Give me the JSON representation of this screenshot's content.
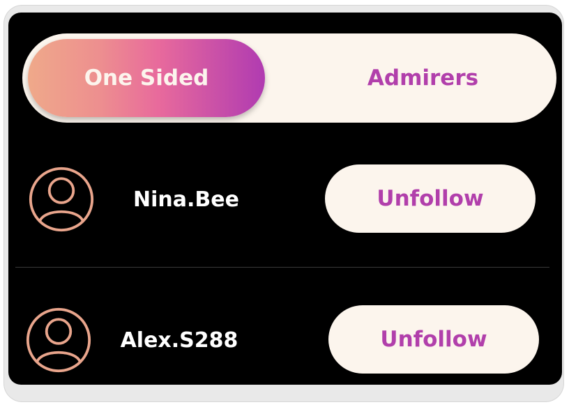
{
  "tabs": {
    "active": "One Sided",
    "inactive": "Admirers"
  },
  "rows": [
    {
      "username": "Nina.Bee",
      "action": "Unfollow"
    },
    {
      "username": "Alex.S288",
      "action": "Unfollow"
    }
  ],
  "colors": {
    "accent": "#b13fab",
    "pill_background": "#fcf5ed",
    "avatar_stroke": "#e9a58c",
    "gradient": [
      "#efa98a",
      "#e86a9c",
      "#b03bb1"
    ],
    "background": "#000000"
  },
  "icons": {
    "avatar": "user-avatar-icon"
  }
}
